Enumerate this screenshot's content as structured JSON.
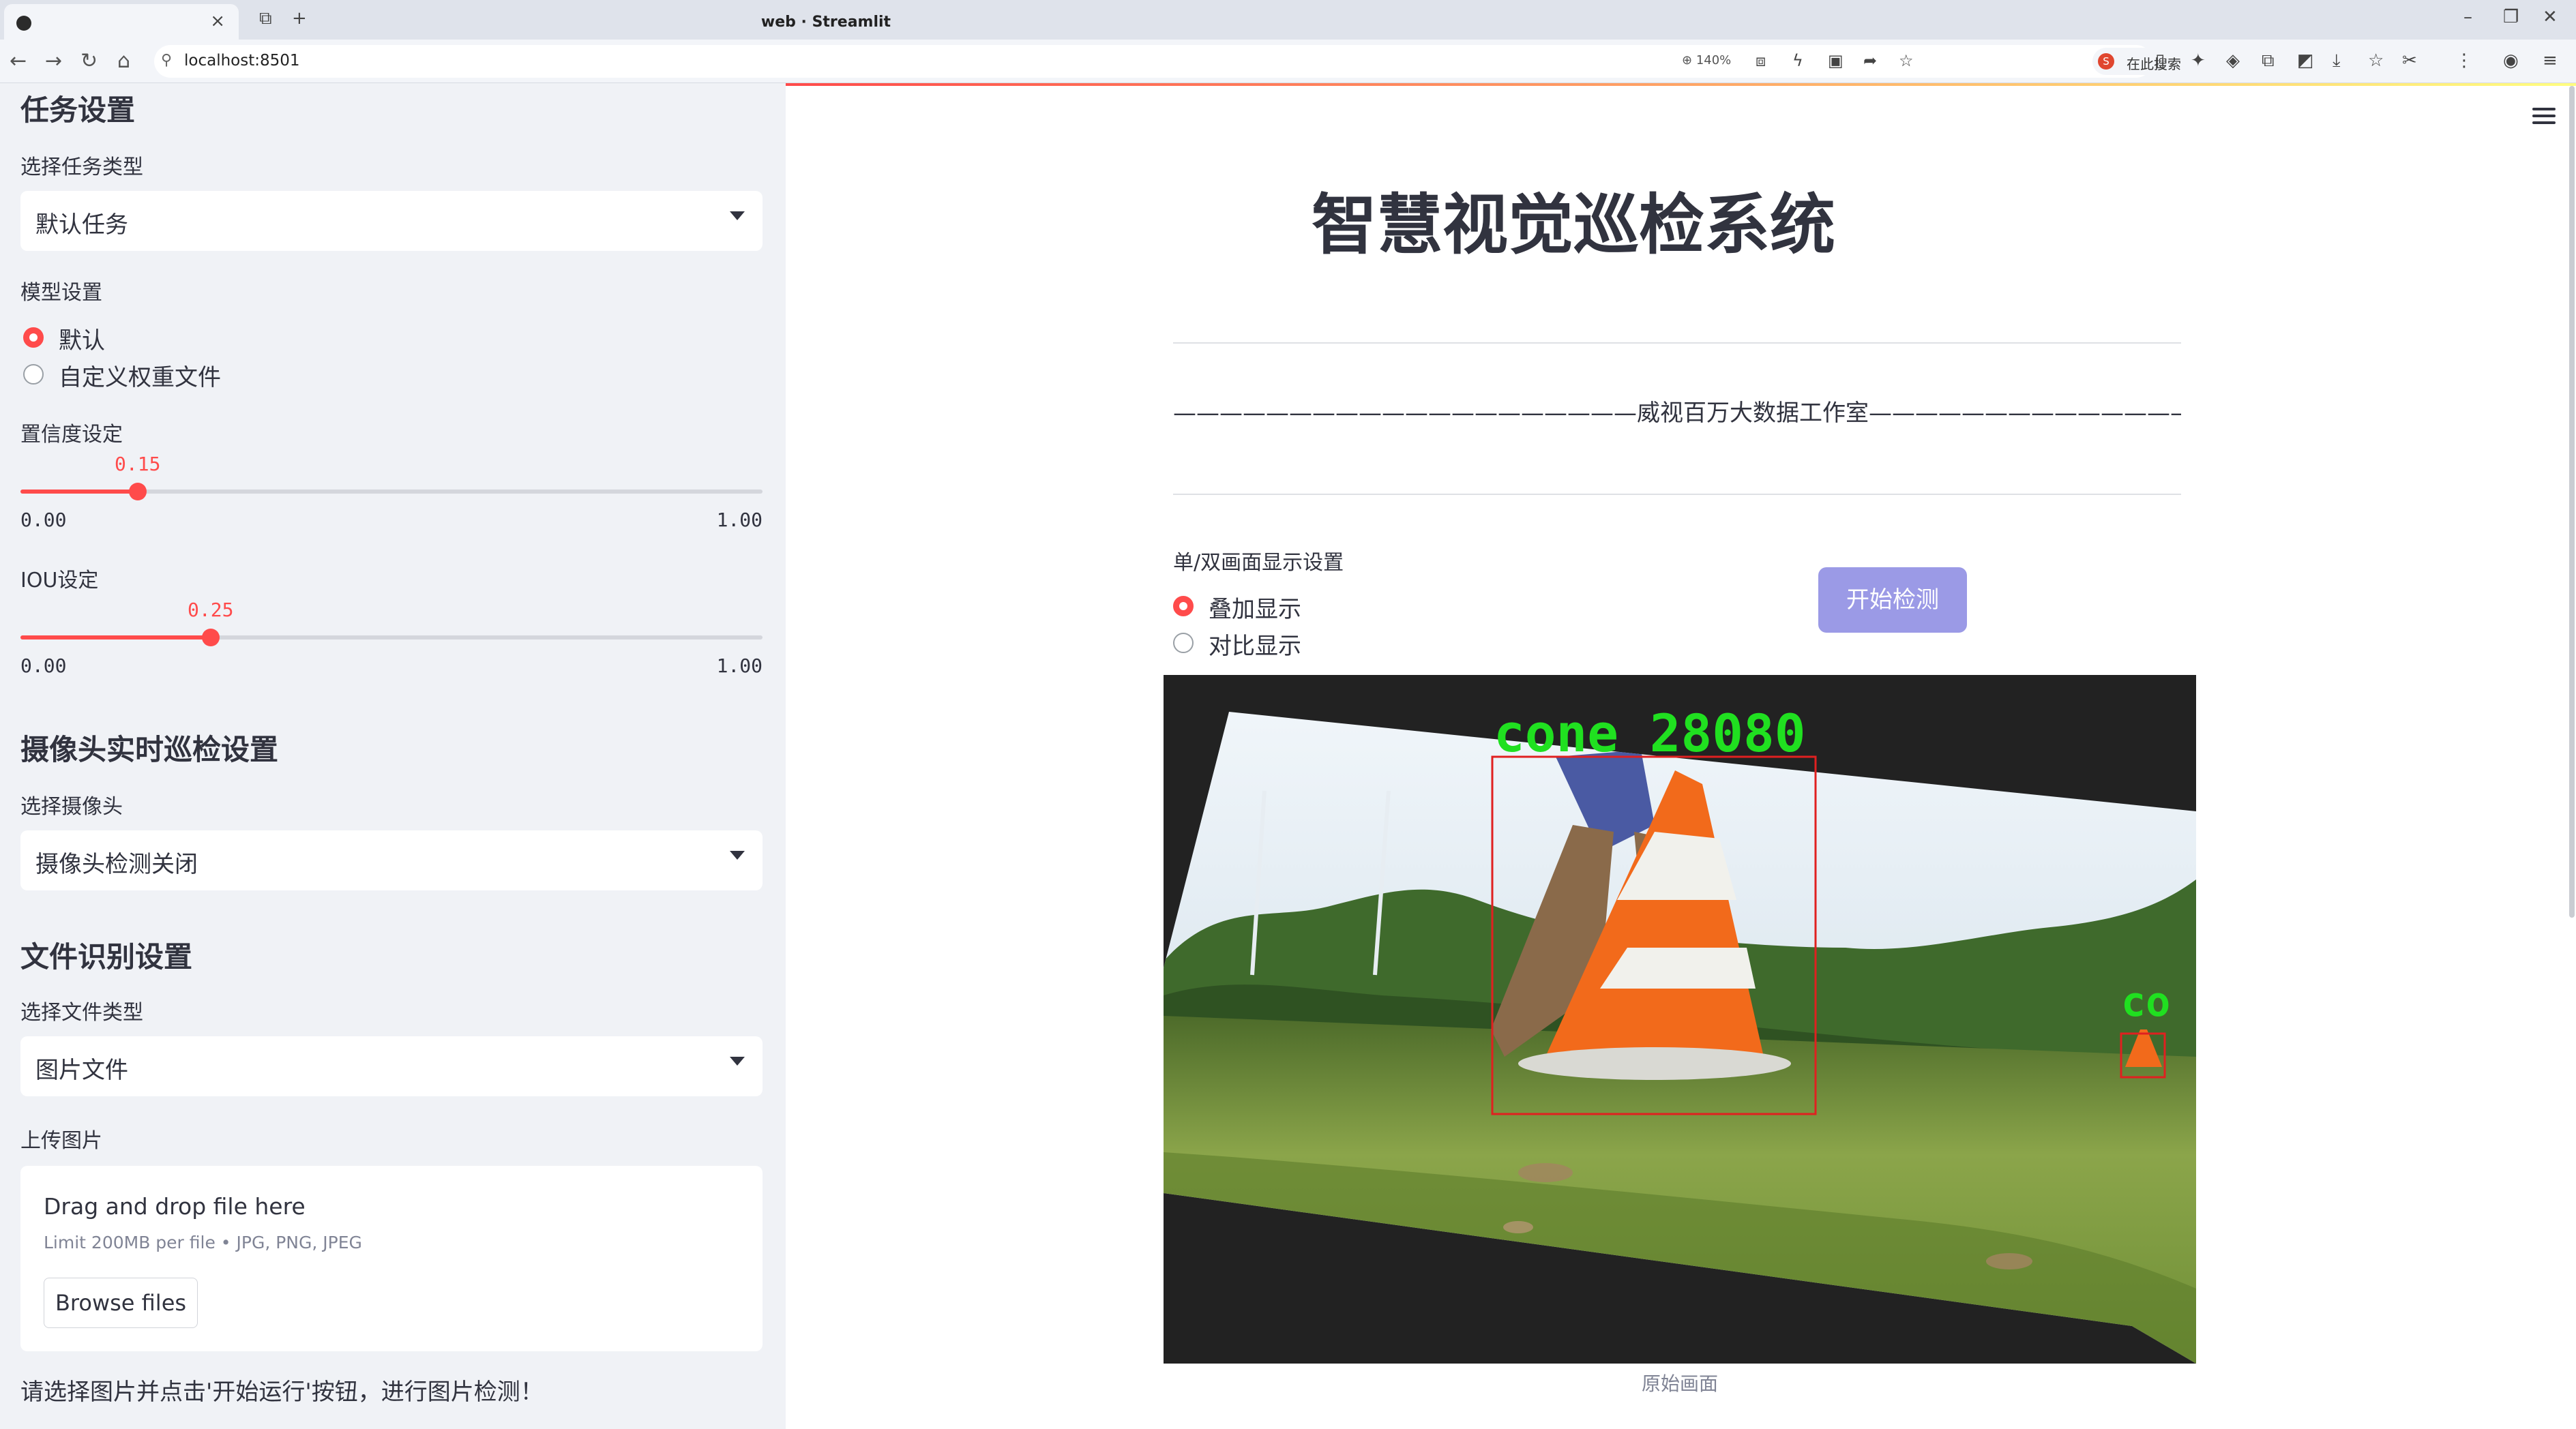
{
  "browser": {
    "tab_title": "web · Streamlit",
    "url": "localhost:8501",
    "zoom": "140%",
    "search_placeholder": "在此搜索",
    "search_badge": "S"
  },
  "sidebar": {
    "task_heading": "任务设置",
    "task_type_label": "选择任务类型",
    "task_type_value": "默认任务",
    "model_label": "模型设置",
    "model_options": [
      "默认",
      "自定义权重文件"
    ],
    "model_selected": 0,
    "conf_label": "置信度设定",
    "conf": {
      "value": "0.15",
      "min": "0.00",
      "max": "1.00",
      "fraction": 0.15
    },
    "iou_label": "IOU设定",
    "iou": {
      "value": "0.25",
      "min": "0.00",
      "max": "1.00",
      "fraction": 0.25
    },
    "camera_heading": "摄像头实时巡检设置",
    "camera_label": "选择摄像头",
    "camera_value": "摄像头检测关闭",
    "file_heading": "文件识别设置",
    "file_type_label": "选择文件类型",
    "file_type_value": "图片文件",
    "upload_label": "上传图片",
    "upload_drag_text": "Drag and drop file here",
    "upload_limit_text": "Limit 200MB per file • JPG, PNG, JPEG",
    "browse_button": "Browse files",
    "hint": "请选择图片并点击'开始运行'按钮，进行图片检测！"
  },
  "main": {
    "title": "智慧视觉巡检系统",
    "subtitle": "————————————————————威视百万大数据工作室————————————————————",
    "display_label": "单/双画面显示设置",
    "display_options": [
      "叠加显示",
      "对比显示"
    ],
    "display_selected": 0,
    "start_button": "开始检测",
    "image_caption": "原始画面",
    "detection_label": "cone 28080",
    "detection_label_partial": "co"
  },
  "colors": {
    "accent": "#ff4b4b",
    "sidebar_bg": "#f0f2f6",
    "start_button_bg": "#9b9ae6",
    "detection_text": "#20e020",
    "detection_box": "#e02020"
  }
}
